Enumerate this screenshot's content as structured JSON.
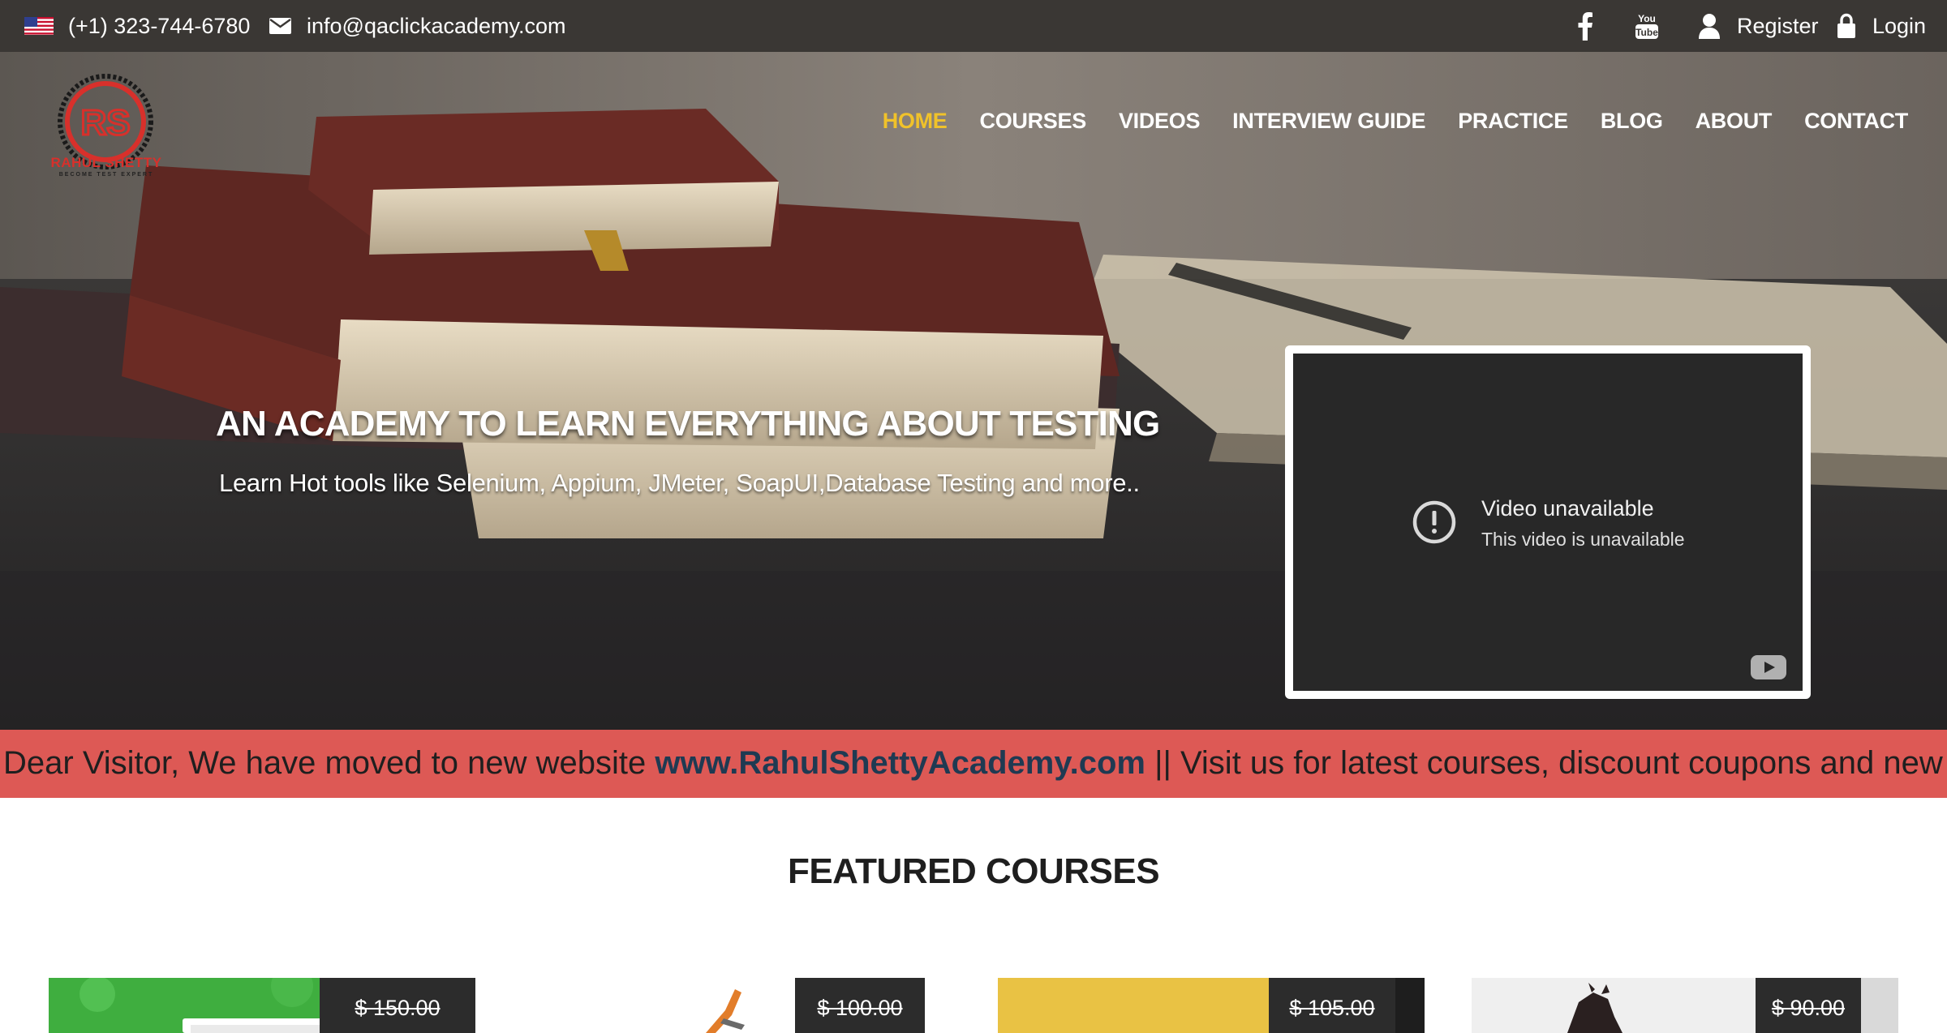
{
  "topbar": {
    "phone": "(+1) 323-744-6780",
    "email": "info@qaclickacademy.com",
    "register": "Register",
    "login": "Login",
    "icons": [
      "us-flag-icon",
      "mail-icon",
      "facebook-icon",
      "youtube-icon",
      "user-icon",
      "lock-icon"
    ]
  },
  "logo": {
    "text": "RAHUL SHETTY",
    "tagline": "BECOME TEST EXPERT"
  },
  "nav": {
    "items": [
      "HOME",
      "COURSES",
      "VIDEOS",
      "INTERVIEW GUIDE",
      "PRACTICE",
      "BLOG",
      "ABOUT",
      "CONTACT"
    ],
    "active": "HOME"
  },
  "hero": {
    "title": "AN ACADEMY TO LEARN EVERYTHING ABOUT TESTING",
    "subtitle": "Learn Hot tools like Selenium, Appium, JMeter, SoapUI,Database Testing and more.."
  },
  "video": {
    "title": "Video unavailable",
    "message": "This video is unavailable"
  },
  "marquee": {
    "prefix": "Dear Visitor, We have moved to new website ",
    "link": "www.RahulShettyAcademy.com",
    "suffix": " || Visit us for latest courses, discount coupons and new prac"
  },
  "featured": {
    "title": "FEATURED COURSES",
    "prices": [
      "$ 150.00",
      "$ 100.00",
      "$ 105.00",
      "$ 90.00"
    ]
  },
  "colors": {
    "topbar": "#3a3734",
    "nav_active": "#f0c22a",
    "marquee_bg": "#dd5955",
    "marquee_link": "#1f3a52",
    "logo_red": "#d8302b"
  }
}
